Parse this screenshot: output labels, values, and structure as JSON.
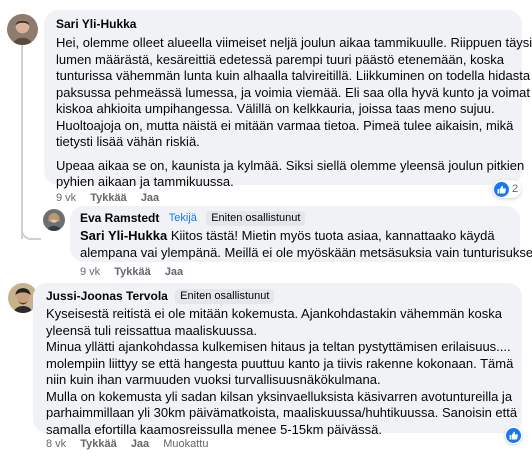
{
  "comments": [
    {
      "author": "Sari Yli-Hukka",
      "paragraphs": [
        [
          "Hei, olemme olleet alueella viimeiset neljä joulun aikaa tammikuulle. Riippuen täysin",
          "lumen määrästä, kesäreittiä edetessä parempi tuuri päästö etenemään, koska",
          "tunturissa vähemmän lunta kuin alhaalla talvireitillä. Liikkuminen on todella hidasta",
          "paksussa pehmeässä lumessa, ja voimia viemää. Eli saa olla hyvä kunto ja voimat",
          "kiskoa ahkioita umpihangessa. Välillä on kelkkauria, joissa taas meno sujuu.",
          "Huoltoajoja on, mutta näistä ei mitään varmaa tietoa. Pimeä tulee aikaisin, mikä",
          "tietysti lisää vähän riskiä."
        ],
        [
          "Upeaa aikaa se on, kaunista ja kylmää. Siksi siellä olemme yleensä joulun pitkien",
          "pyhien aikaan ja tammikuussa."
        ]
      ],
      "time": "9 vk",
      "like": "Tykkää",
      "reply": "Jaa",
      "reaction_count": "2"
    },
    {
      "author": "Eva Ramstedt",
      "author_badge": "Tekijä",
      "top_badge": "Eniten osallistunut",
      "mention": "Sari Yli-Hukka",
      "lines": [
        " Kiitos tästä! Mietin myös tuota asiaa, kannattaako käydä",
        "alempana vai ylempänä. Meillä ei ole myöskään metsäsuksia vain tunturisukset."
      ],
      "time": "9 vk",
      "like": "Tykkää",
      "reply": "Jaa"
    },
    {
      "author": "Jussi-Joonas Tervola",
      "top_badge": "Eniten osallistunut",
      "lines": [
        "Kyseisestä reitistä ei ole mitään kokemusta. Ajankohdastakin vähemmän koska",
        "yleensä tuli reissattua maaliskuussa.",
        "Minua yllätti ajankohdassa kulkemisen hitaus ja teltan pystyttämisen erilaisuus....",
        "molempiin liittyy se että hangesta puuttuu kanto ja tiivis rakenne kokonaan. Tämä",
        "niin kuin ihan varmuuden vuoksi turvallisuusnäkökulmana.",
        "Mulla on kokemusta yli sadan kilsan yksinvaelluksista käsivarren avotuntureilla ja",
        "parhaimmillaan yli 30km päivämatkoista, maaliskuussa/huhtikuussa. Sanoisin että",
        "samalla efortilla kaamosreissulla menee 5-15km päivässä."
      ],
      "time": "8 vk",
      "like": "Tykkää",
      "reply": "Jaa",
      "edited": "Muokattu"
    }
  ],
  "colors": {
    "bubble": "#f0f2f5",
    "meta": "#65676b",
    "like_blue": "#1877f2",
    "author_badge_text": "#1877f2",
    "top_badge_bg": "#e4e6eb"
  },
  "icons": [
    "like-icon"
  ]
}
